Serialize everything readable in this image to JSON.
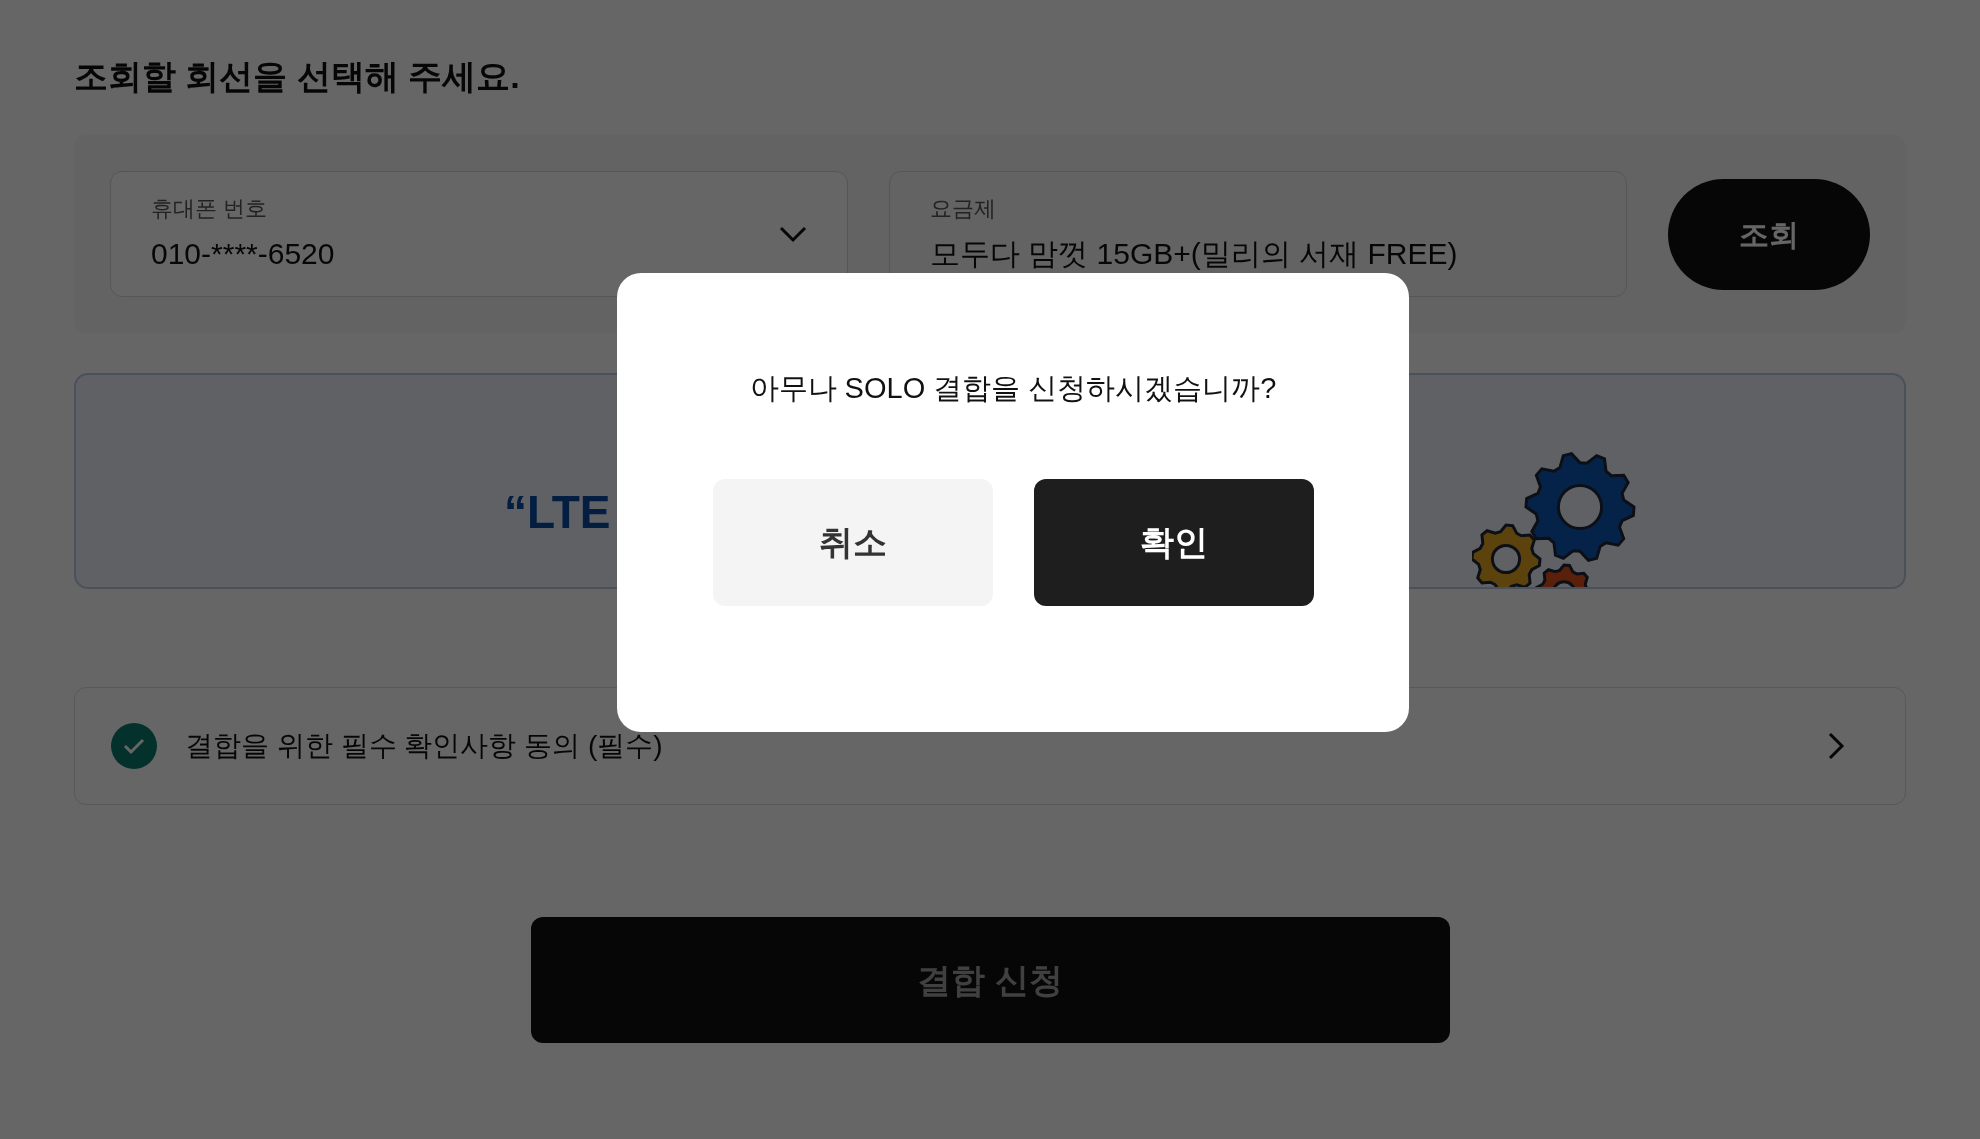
{
  "page_title": "조회할 회선을 선택해 주세요.",
  "form": {
    "phone": {
      "label": "휴대폰 번호",
      "value": "010-****-6520"
    },
    "plan": {
      "label": "요금제",
      "value": "모두다 맘껏 15GB+(밀리의 서재 FREE)"
    },
    "search_button": "조회"
  },
  "banner": {
    "headline": "“LTE"
  },
  "agreement": {
    "label": "결합을 위한 필수 확인사항 동의 (필수)",
    "checked": true
  },
  "submit_button": "결합 신청",
  "dialog": {
    "message": "아무나 SOLO 결합을 신청하시겠습니까?",
    "buttons": [
      {
        "label": "취소",
        "kind": "secondary"
      },
      {
        "label": "확인",
        "kind": "primary"
      }
    ]
  }
}
